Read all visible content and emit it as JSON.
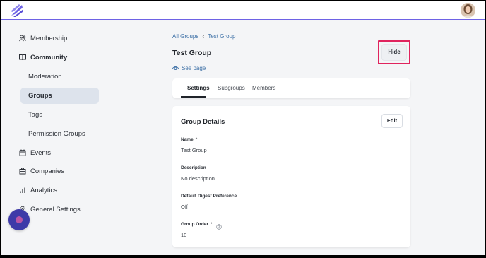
{
  "header": {
    "logo_icon": "brand-feather-logo",
    "avatar_icon": "user-avatar",
    "accent": "#6e62e5"
  },
  "sidebar": {
    "items": [
      {
        "label": "Membership",
        "icon": "members-icon"
      },
      {
        "label": "Community",
        "icon": "book-icon"
      },
      {
        "label": "Moderation"
      },
      {
        "label": "Groups",
        "active": true
      },
      {
        "label": "Tags"
      },
      {
        "label": "Permission Groups"
      },
      {
        "label": "Events",
        "icon": "calendar-icon"
      },
      {
        "label": "Companies",
        "icon": "building-icon"
      },
      {
        "label": "Analytics",
        "icon": "bar-chart-icon"
      },
      {
        "label": "General Settings",
        "icon": "gear-icon"
      }
    ],
    "active_bg": "#dde3ec"
  },
  "breadcrumb": {
    "root": "All Groups",
    "current": "Test Group"
  },
  "page": {
    "title": "Test Group",
    "see_page": "See page",
    "hide_label": "Hide",
    "highlight_color": "#e0245e"
  },
  "tabs": [
    {
      "label": "Settings",
      "active": true
    },
    {
      "label": "Subgroups"
    },
    {
      "label": "Members"
    }
  ],
  "details": {
    "title": "Group Details",
    "edit_label": "Edit",
    "fields": [
      {
        "label": "Name",
        "required": "*",
        "value": "Test Group"
      },
      {
        "label": "Description",
        "value": "No description"
      },
      {
        "label": "Default Digest Preference",
        "value": "Off"
      },
      {
        "label": "Group Order",
        "required": "*",
        "value": "10"
      }
    ]
  }
}
